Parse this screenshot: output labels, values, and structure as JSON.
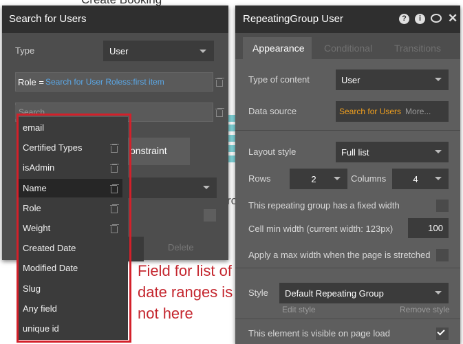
{
  "background": {
    "title_fragment": "Create Booking",
    "partial_text": "ro"
  },
  "left_panel": {
    "title": "Search for Users",
    "type_label": "Type",
    "type_value": "User",
    "constraint_field": "Role =",
    "constraint_value": "Search for User Roless:first item",
    "search_placeholder": "Search...",
    "add_constraint_fragment": "onstraint",
    "delete_label": "Delete"
  },
  "dropdown": {
    "items": [
      "email",
      "Certified Types",
      "isAdmin",
      "Name",
      "Role",
      "Weight",
      "Created Date",
      "Modified Date",
      "Slug",
      "Any field",
      "unique id"
    ],
    "active_index": 3
  },
  "annotation": {
    "text": "Field for list of date ranges is not here",
    "color": "#d3202a"
  },
  "right_panel": {
    "title": "RepeatingGroup User",
    "header_icons": [
      "help-icon",
      "info-icon",
      "comment-icon",
      "close-icon"
    ],
    "tabs": [
      "Appearance",
      "Conditional",
      "Transitions"
    ],
    "type_of_content_label": "Type of content",
    "type_of_content_value": "User",
    "data_source_label": "Data source",
    "data_source_value": "Search for Users",
    "data_source_more": "More...",
    "layout_style_label": "Layout style",
    "layout_style_value": "Full list",
    "rows_label": "Rows",
    "rows_value": "2",
    "columns_label": "Columns",
    "columns_value": "4",
    "fixed_width_label": "This repeating group has a fixed width",
    "cell_min_width_label": "Cell min width (current width: 123px)",
    "cell_min_width_value": "100",
    "max_width_label": "Apply a max width when the page is stretched",
    "style_label": "Style",
    "style_value": "Default Repeating Group",
    "edit_style": "Edit style",
    "remove_style": "Remove style",
    "visible_label": "This element is visible on page load",
    "visible_checked": true
  }
}
